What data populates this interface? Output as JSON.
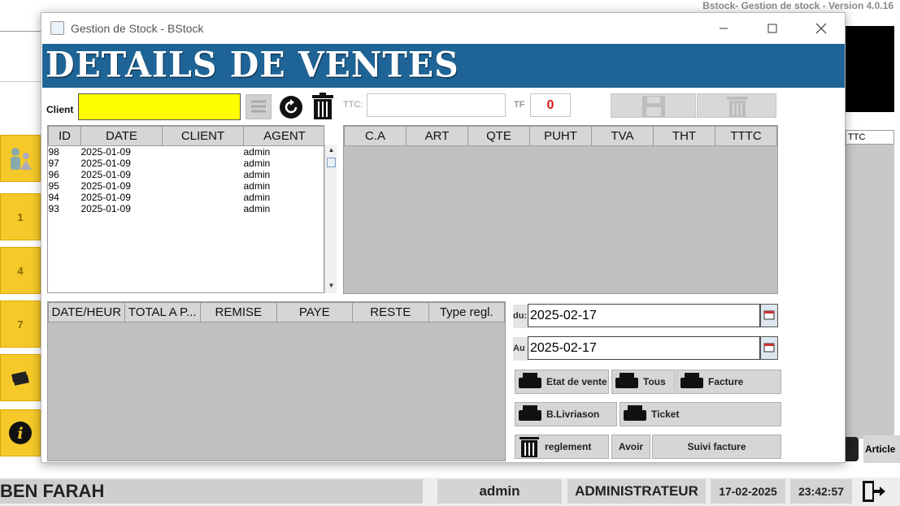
{
  "app_version": "Bstock- Gestion de stock - Version 4.0.16",
  "sidebar_buttons": [
    "1",
    "4",
    "7"
  ],
  "window": {
    "title": "Gestion de Stock - BStock",
    "banner": "DETAILS DE VENTES"
  },
  "form": {
    "client_label": "Client",
    "client_value": "",
    "ttc_label": "TTC:",
    "ttc_value": "",
    "tf_label": "TF",
    "tf_value": "0"
  },
  "sales_table": {
    "columns": [
      "ID",
      "DATE",
      "CLIENT",
      "AGENT"
    ],
    "rows": [
      {
        "id": "98",
        "date": "2025-01-09",
        "client": "",
        "agent": "admin"
      },
      {
        "id": "97",
        "date": "2025-01-09",
        "client": "",
        "agent": "admin"
      },
      {
        "id": "96",
        "date": "2025-01-09",
        "client": "",
        "agent": "admin"
      },
      {
        "id": "95",
        "date": "2025-01-09",
        "client": "",
        "agent": "admin"
      },
      {
        "id": "94",
        "date": "2025-01-09",
        "client": "",
        "agent": "admin"
      },
      {
        "id": "93",
        "date": "2025-01-09",
        "client": "",
        "agent": "admin"
      }
    ]
  },
  "detail_table": {
    "columns": [
      "C.A",
      "ART",
      "QTE",
      "PUHT",
      "TVA",
      "THT",
      "TTTC"
    ]
  },
  "reglement_table": {
    "columns": [
      "DATE/HEUR",
      "TOTAL A P...",
      "REMISE",
      "PAYE",
      "RESTE",
      "Type regl."
    ]
  },
  "dates": {
    "du_label": "du:",
    "du_value": "2025-02-17",
    "au_label": "Au",
    "au_value": "2025-02-17"
  },
  "buttons": {
    "etat_vente": "Etat de vente",
    "tous": "Tous",
    "facture": "Facture",
    "livraison": "B.Livriason",
    "ticket": "Ticket",
    "reglement": "reglement",
    "avoir": "Avoir",
    "suivi_facture": "Suivi facture"
  },
  "background": {
    "ttc_header": "TTC",
    "article": "Article"
  },
  "status_bar": {
    "name": "BEN FARAH",
    "user": "admin",
    "role": "ADMINISTRATEUR",
    "date": "17-02-2025",
    "time": "23:42:57"
  },
  "colors": {
    "banner": "#1f6496",
    "client_field": "#ffff00",
    "tf_value": "#d51c1c",
    "sidebar_button": "#f6c92a"
  }
}
